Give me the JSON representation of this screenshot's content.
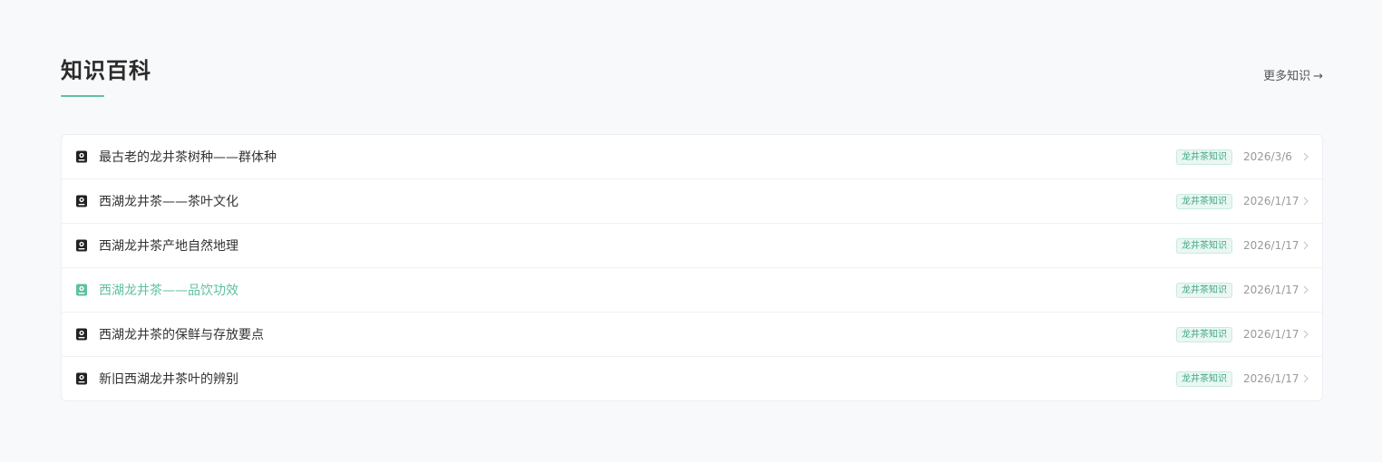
{
  "section": {
    "title": "知识百科",
    "more_label": "更多知识",
    "more_arrow": "→"
  },
  "colors": {
    "accent": "#5fc0a0",
    "tag_text": "#3fa783",
    "tag_bg": "#eaf7f2"
  },
  "icons": {
    "row_icon": "book-icon",
    "row_chevron": "chevron-right-icon"
  },
  "items": [
    {
      "title": "最古老的龙井茶树种——群体种",
      "tag": "龙井茶知识",
      "date": "2026/3/6",
      "active": false
    },
    {
      "title": "西湖龙井茶——茶叶文化",
      "tag": "龙井茶知识",
      "date": "2026/1/17",
      "active": false
    },
    {
      "title": "西湖龙井茶产地自然地理",
      "tag": "龙井茶知识",
      "date": "2026/1/17",
      "active": false
    },
    {
      "title": "西湖龙井茶——品饮功效",
      "tag": "龙井茶知识",
      "date": "2026/1/17",
      "active": true
    },
    {
      "title": "西湖龙井茶的保鲜与存放要点",
      "tag": "龙井茶知识",
      "date": "2026/1/17",
      "active": false
    },
    {
      "title": "新旧西湖龙井茶叶的辨别",
      "tag": "龙井茶知识",
      "date": "2026/1/17",
      "active": false
    }
  ]
}
